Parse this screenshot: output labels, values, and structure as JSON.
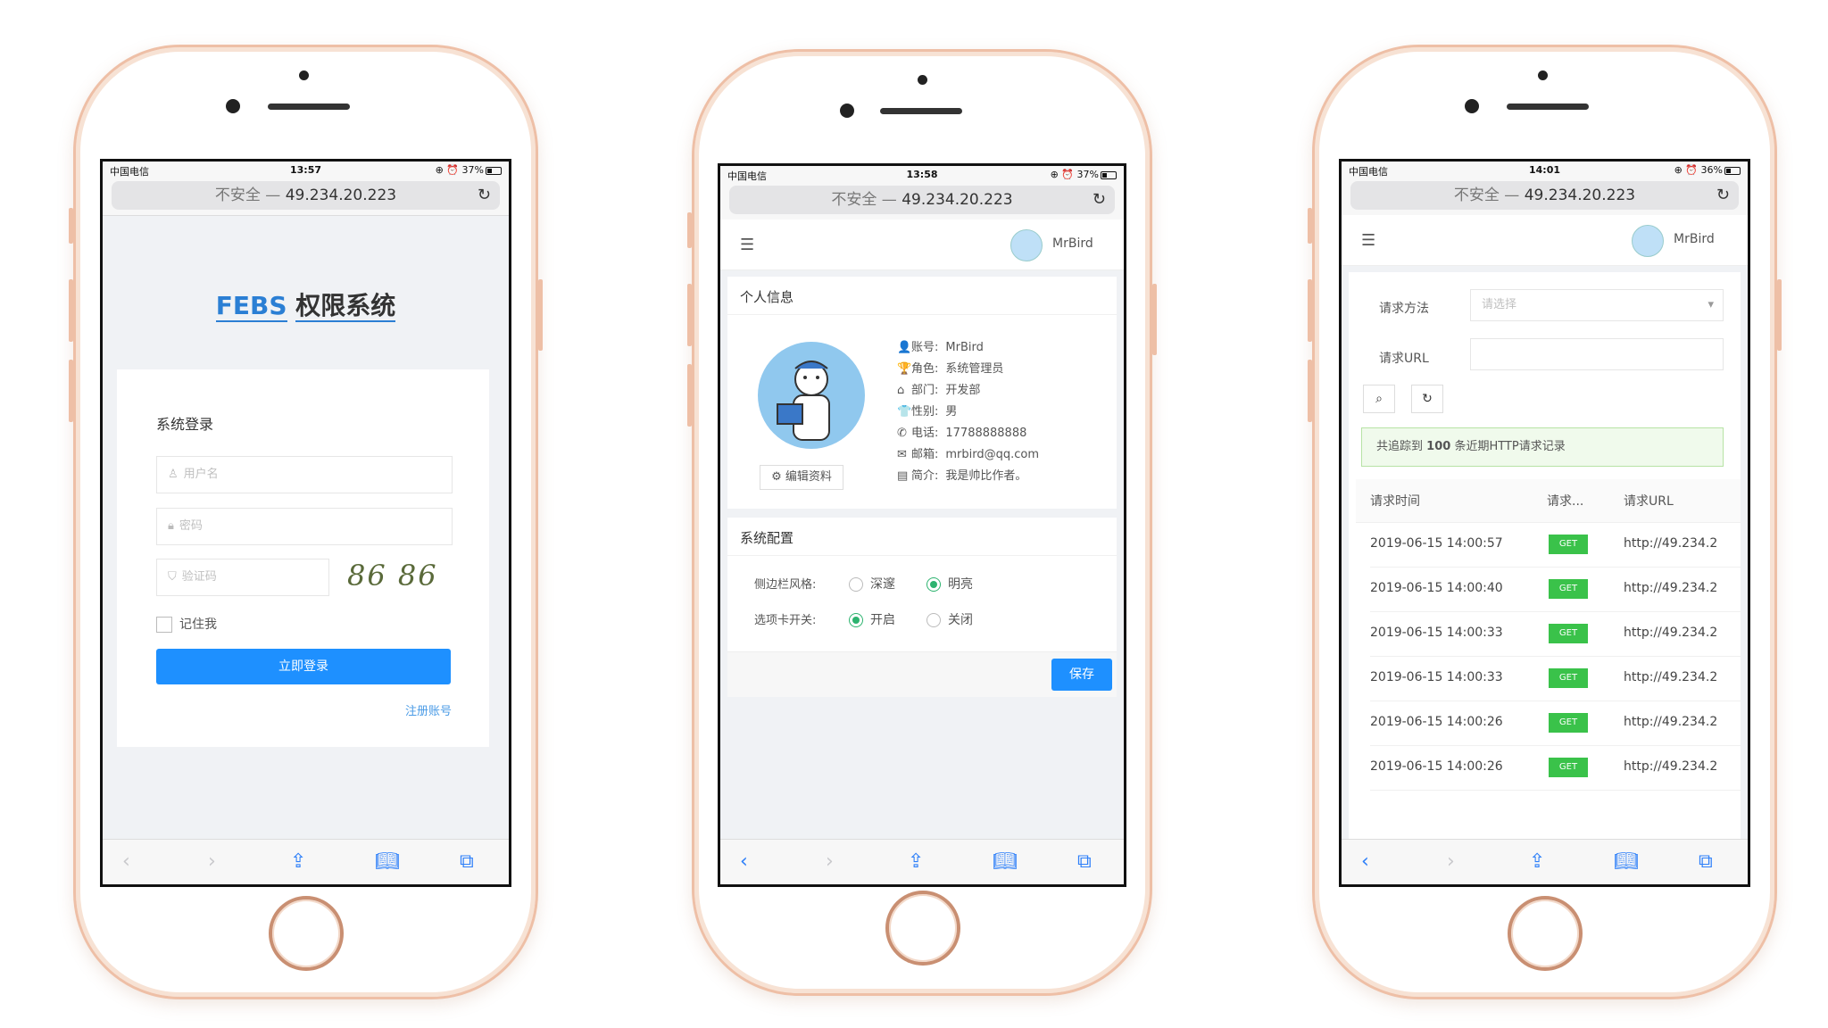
{
  "colors": {
    "phone_frame": "#eebfa6",
    "primary": "#1e90ff",
    "success": "#2db36f",
    "get_badge": "#3ac24a",
    "link": "#2d7ff9"
  },
  "phones": [
    {
      "status": {
        "carrier": "中国电信",
        "time": "13:57",
        "battery": "37%"
      },
      "url": {
        "insecure": "不安全 —",
        "host": "49.234.20.223"
      },
      "login": {
        "brand": "FEBS",
        "system_name": "权限系统",
        "card_title": "系统登录",
        "username_placeholder": "用户名",
        "password_placeholder": "密码",
        "captcha_placeholder": "验证码",
        "captcha_text": "86 86",
        "remember_label": "记住我",
        "login_button": "立即登录",
        "register_link": "注册账号"
      }
    },
    {
      "status": {
        "carrier": "中国电信",
        "time": "13:58",
        "battery": "37%"
      },
      "url": {
        "insecure": "不安全 —",
        "host": "49.234.20.223"
      },
      "header": {
        "username": "MrBird"
      },
      "profile": {
        "title": "个人信息",
        "edit_button": "编辑资料",
        "fields": [
          {
            "icon": "user-icon",
            "glyph": "👤",
            "label": "账号:",
            "value": "MrBird"
          },
          {
            "icon": "trophy-icon",
            "glyph": "🏆",
            "label": "角色:",
            "value": "系统管理员"
          },
          {
            "icon": "home-icon",
            "glyph": "⌂",
            "label": "部门:",
            "value": "开发部"
          },
          {
            "icon": "shirt-icon",
            "glyph": "👕",
            "label": "性别:",
            "value": "男"
          },
          {
            "icon": "phone-icon",
            "glyph": "✆",
            "label": "电话:",
            "value": "17788888888"
          },
          {
            "icon": "mail-icon",
            "glyph": "✉",
            "label": "邮箱:",
            "value": "mrbird@qq.com"
          },
          {
            "icon": "book-icon",
            "glyph": "▤",
            "label": "简介:",
            "value": "我是帅比作者。"
          }
        ]
      },
      "config": {
        "title": "系统配置",
        "sidebar_label": "侧边栏风格:",
        "sidebar_opt_dark": "深邃",
        "sidebar_opt_light": "明亮",
        "tab_label": "选项卡开关:",
        "tab_opt_on": "开启",
        "tab_opt_off": "关闭",
        "save_button": "保存"
      }
    },
    {
      "status": {
        "carrier": "中国电信",
        "time": "14:01",
        "battery": "36%"
      },
      "url": {
        "insecure": "不安全 —",
        "host": "49.234.20.223"
      },
      "header": {
        "username": "MrBird"
      },
      "filter": {
        "method_label": "请求方法",
        "method_placeholder": "请选择",
        "url_label": "请求URL",
        "url_value": ""
      },
      "alert": {
        "prefix": "共追踪到",
        "count": "100",
        "suffix": "条近期HTTP请求记录"
      },
      "table": {
        "headers": [
          "请求时间",
          "请求...",
          "请求URL"
        ],
        "rows": [
          {
            "time": "2019-06-15 14:00:57",
            "method": "GET",
            "url": "http://49.234.2"
          },
          {
            "time": "2019-06-15 14:00:40",
            "method": "GET",
            "url": "http://49.234.2"
          },
          {
            "time": "2019-06-15 14:00:33",
            "method": "GET",
            "url": "http://49.234.2"
          },
          {
            "time": "2019-06-15 14:00:33",
            "method": "GET",
            "url": "http://49.234.2"
          },
          {
            "time": "2019-06-15 14:00:26",
            "method": "GET",
            "url": "http://49.234.2"
          },
          {
            "time": "2019-06-15 14:00:26",
            "method": "GET",
            "url": "http://49.234.2"
          }
        ]
      }
    }
  ]
}
